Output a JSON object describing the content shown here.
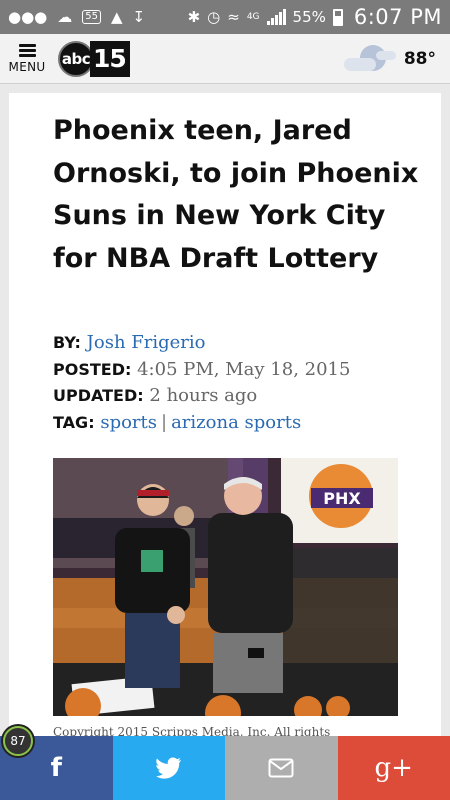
{
  "status_bar": {
    "notification_count": "55",
    "network": "4G",
    "battery": "55%",
    "time": "6:07 PM"
  },
  "header": {
    "menu_label": "MENU",
    "logo_abc": "abc",
    "logo_number": "15",
    "temperature": "88°",
    "weather_icon": "partly-cloudy-icon"
  },
  "article": {
    "headline": "Phoenix teen, Jared Ornoski, to join Phoenix Suns in New York City for NBA Draft Lottery",
    "by_label": "BY:",
    "author": "Josh Frigerio",
    "posted_label": "POSTED:",
    "posted": "4:05 PM, May 18, 2015",
    "updated_label": "UPDATED:",
    "updated": "2 hours ago",
    "tag_label": "TAG:",
    "tags": [
      "sports",
      "arizona sports"
    ],
    "photo_banner_text": "PHX",
    "caption": "Copyright 2015 Scripps Media, Inc. All rights"
  },
  "share_bar": {
    "facebook": "f",
    "twitter": "twitter-bird-icon",
    "email": "mail-icon",
    "google_plus": "g+"
  },
  "floating_badge": {
    "count": "87"
  },
  "colors": {
    "status_bar": "#7b7b7b",
    "link": "#2a6ab1",
    "facebook": "#3b5998",
    "twitter": "#27aaf0",
    "email": "#aeaeae",
    "google_plus": "#dd4b39"
  }
}
